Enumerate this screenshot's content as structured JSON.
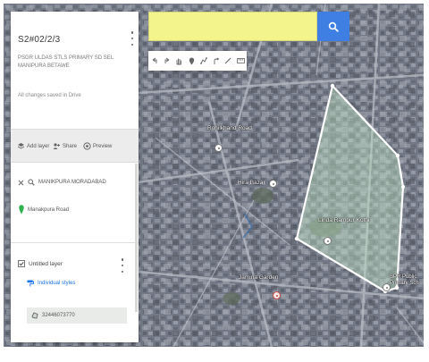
{
  "panel": {
    "map_title": "S2#02/2/3",
    "description": "PSGR ULDAS STLS PRIMARY SD SEL MANIPURA BETAWE",
    "saved_status": "All changes saved in Drive",
    "actions": [
      {
        "label": "Add layer",
        "icon": "layers-icon"
      },
      {
        "label": "Share",
        "icon": "share-icon"
      },
      {
        "label": "Preview",
        "icon": "preview-icon"
      }
    ],
    "search_layer": {
      "query": "MANIKPURA MORADABAD",
      "result": "Manakpura Road"
    },
    "layer": {
      "title": "Untitled layer",
      "styles_label": "Individual styles",
      "item": "32446073770"
    }
  },
  "search": {
    "value": ""
  },
  "toolbar": {
    "tools": [
      "undo-icon",
      "redo-icon",
      "pan-hand-icon",
      "add-marker-icon",
      "draw-line-icon",
      "directions-icon",
      "measure-icon",
      "ruler-icon"
    ]
  },
  "map": {
    "places": [
      {
        "name": "Rohilkhand Road"
      },
      {
        "name": "Hira Bazar"
      },
      {
        "name": "Linda Rampur Kothi"
      },
      {
        "name": "Jamina Garden"
      },
      {
        "name": "SPR Public Primary Sch"
      }
    ],
    "polygon_color": "#ffffff",
    "polygon_fill": "#bfe3c4"
  },
  "colors": {
    "search_bg": "#f3f58c",
    "search_button": "#3f7fe4",
    "accent_link": "#1a73e8",
    "marker_green": "#2fb34a"
  }
}
